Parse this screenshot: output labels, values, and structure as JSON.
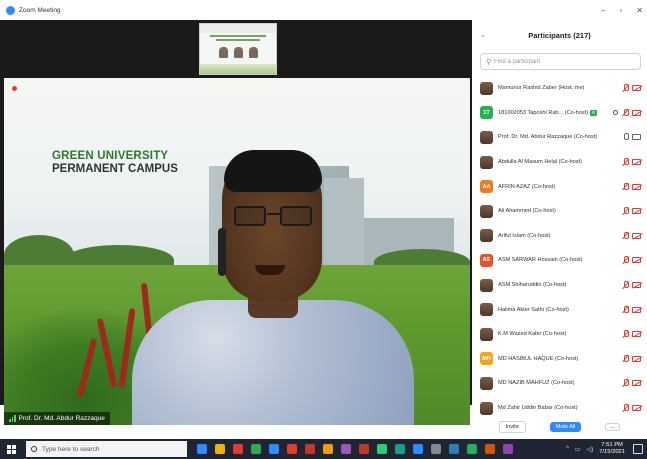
{
  "window": {
    "title": "Zoom Meeting",
    "controls": {
      "minimize": "–",
      "restore": "▫",
      "close": "✕"
    }
  },
  "video": {
    "background_text": {
      "line1": "GREEN UNIVERSITY",
      "line2": "PERMANENT CAMPUS"
    },
    "speaker_name": "Prof. Dr. Md. Abdur Razzaque"
  },
  "participants": {
    "title": "Participants (217)",
    "search_placeholder": "Find a participant",
    "items": [
      {
        "name": "Mamunur Rashid Zaber (Host, me)",
        "avatar": "photo",
        "avatar_text": "",
        "avatar_color": "",
        "mic": "muted",
        "cam": "off",
        "badge": ""
      },
      {
        "name": "181002053 Taposhi Rab... (Co-host)",
        "avatar": "initials",
        "avatar_text": "1T",
        "avatar_color": "#22b14c",
        "mic": "muted",
        "cam": "off",
        "badge": "R"
      },
      {
        "name": "Prof. Dr. Md. Abdur Razzaque (Co-host)",
        "avatar": "photo",
        "avatar_text": "",
        "avatar_color": "",
        "mic": "on",
        "cam": "on",
        "badge": ""
      },
      {
        "name": "Abdulla Al Masum Helal (Co-host)",
        "avatar": "photo",
        "avatar_text": "",
        "avatar_color": "",
        "mic": "muted",
        "cam": "off",
        "badge": ""
      },
      {
        "name": "AFRIN AZAZ (Co-host)",
        "avatar": "initials",
        "avatar_text": "AA",
        "avatar_color": "#f07b1f",
        "mic": "muted",
        "cam": "off",
        "badge": ""
      },
      {
        "name": "Ali Ahammed (Co-host)",
        "avatar": "photo",
        "avatar_text": "",
        "avatar_color": "",
        "mic": "muted",
        "cam": "off",
        "badge": ""
      },
      {
        "name": "Ariful Islam (Co-host)",
        "avatar": "photo",
        "avatar_text": "",
        "avatar_color": "",
        "mic": "muted",
        "cam": "off",
        "badge": ""
      },
      {
        "name": "ASM SARWAR Hossain (Co-host)",
        "avatar": "initials",
        "avatar_text": "AS",
        "avatar_color": "#e0552b",
        "mic": "muted",
        "cam": "off",
        "badge": ""
      },
      {
        "name": "ASM Shiharuddin (Co-host)",
        "avatar": "photo",
        "avatar_text": "",
        "avatar_color": "",
        "mic": "muted",
        "cam": "off",
        "badge": ""
      },
      {
        "name": "Halima Akter Sathi (Co-host)",
        "avatar": "photo",
        "avatar_text": "",
        "avatar_color": "",
        "mic": "muted",
        "cam": "off",
        "badge": ""
      },
      {
        "name": "K.M Wazed Kabir (Co-host)",
        "avatar": "photo",
        "avatar_text": "",
        "avatar_color": "",
        "mic": "muted",
        "cam": "off",
        "badge": ""
      },
      {
        "name": "MD HASIBUL HAQUE (Co-host)",
        "avatar": "initials",
        "avatar_text": "MH",
        "avatar_color": "#f3a51c",
        "mic": "muted",
        "cam": "off",
        "badge": ""
      },
      {
        "name": "MD NAZIB MAHFUZ (Co-host)",
        "avatar": "photo",
        "avatar_text": "",
        "avatar_color": "",
        "mic": "muted",
        "cam": "off",
        "badge": ""
      },
      {
        "name": "Md Zahir Uddin Babar (Co-host)",
        "avatar": "photo",
        "avatar_text": "",
        "avatar_color": "",
        "mic": "muted",
        "cam": "off",
        "badge": ""
      }
    ],
    "footer": {
      "invite": "Invite",
      "mute_all": "Mute All",
      "more": "..."
    }
  },
  "taskbar": {
    "search_placeholder": "Type here to search",
    "time": "7:51 PM",
    "date": "7/15/2021",
    "apps": [
      "#2d8cff",
      "#f0b400",
      "#e03c31",
      "#34a853",
      "#2d8cff",
      "#e03c31",
      "#c0392b",
      "#f39c12",
      "#9b59b6",
      "#c0392b",
      "#2ecc71",
      "#16a085",
      "#2d8cff",
      "#7f8c8d",
      "#2980b9",
      "#27ae60",
      "#d35400",
      "#8e44ad"
    ]
  },
  "colors": {
    "accent": "#2d8cff",
    "muted": "#e03c31",
    "taskbar": "#1f2533"
  }
}
